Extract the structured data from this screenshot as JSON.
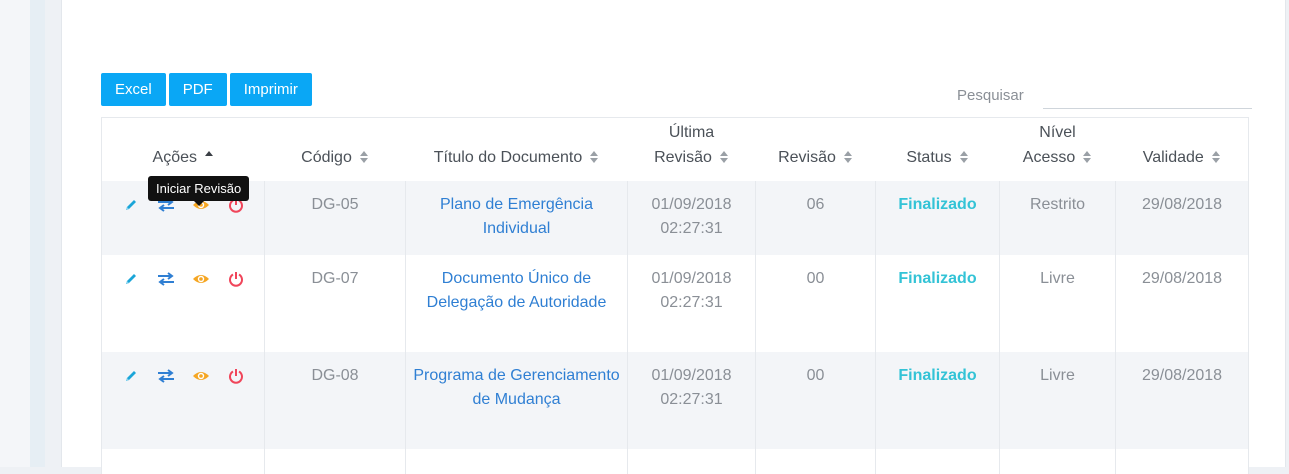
{
  "export_buttons": [
    {
      "label": "Excel"
    },
    {
      "label": "PDF"
    },
    {
      "label": "Imprimir"
    }
  ],
  "search": {
    "label": "Pesquisar",
    "value": "",
    "placeholder": ""
  },
  "table": {
    "headers": {
      "acoes": "Ações",
      "codigo": "Código",
      "titulo": "Título do Documento",
      "ultima_revisao_1": "Última",
      "ultima_revisao_2": "Revisão",
      "revisao": "Revisão",
      "status": "Status",
      "nivel_acesso_1": "Nível",
      "nivel_acesso_2": "Acesso",
      "validade": "Validade"
    },
    "rows": [
      {
        "codigo": "DG-05",
        "titulo": "Plano de Emergência Individual",
        "data": "01/09/2018",
        "hora": "02:27:31",
        "revisao": "06",
        "status": "Finalizado",
        "nivel": "Restrito",
        "validade": "29/08/2018"
      },
      {
        "codigo": "DG-07",
        "titulo": "Documento Único de Delegação de Autoridade",
        "data": "01/09/2018",
        "hora": "02:27:31",
        "revisao": "00",
        "status": "Finalizado",
        "nivel": "Livre",
        "validade": "29/08/2018"
      },
      {
        "codigo": "DG-08",
        "titulo": "Programa de Gerenciamento de Mudança",
        "data": "01/09/2018",
        "hora": "02:27:31",
        "revisao": "00",
        "status": "Finalizado",
        "nivel": "Livre",
        "validade": "29/08/2018"
      }
    ]
  },
  "tooltip": {
    "text": "Iniciar Revisão"
  },
  "icons": {
    "edit": "pencil-icon",
    "swap": "swap-arrows-icon",
    "view": "eye-icon",
    "power": "power-icon"
  },
  "colors": {
    "button": "#0aa7f5",
    "link": "#2f7fd3",
    "status": "#33c3d6",
    "edit_icon": "#1aa5d8",
    "swap_icon": "#2f7fd3",
    "view_icon": "#f5a623",
    "power_icon": "#f0455a"
  }
}
